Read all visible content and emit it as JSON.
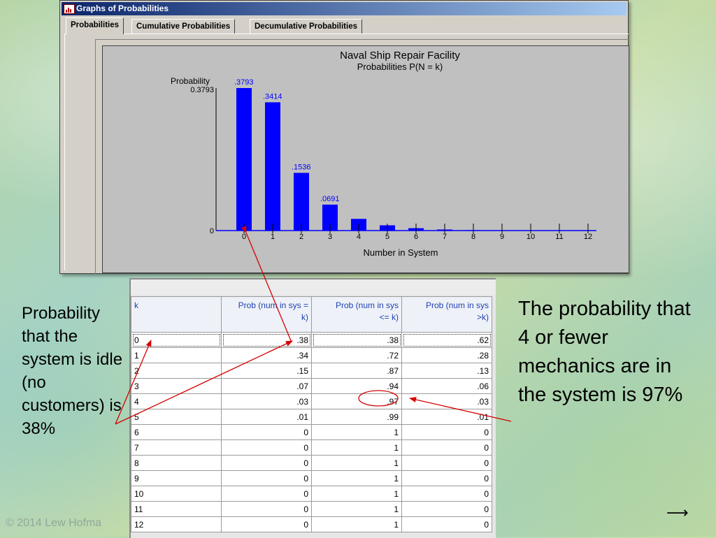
{
  "window": {
    "title": "Graphs of Probabilities",
    "tabs": [
      "Probabilities",
      "Cumulative Probabilities",
      "Decumulative Probabilities"
    ],
    "active_tab": "Probabilities"
  },
  "chart_data": {
    "type": "bar",
    "title": "Naval Ship Repair Facility",
    "subtitle": "Probabilities P(N = k)",
    "ylabel": "Probability",
    "xlabel": "Number in System",
    "ymax_label": "0.3793",
    "ymin_label": "0",
    "ylim": [
      0,
      0.3793
    ],
    "categories": [
      "0",
      "1",
      "2",
      "3",
      "4",
      "5",
      "6",
      "7",
      "8",
      "9",
      "10",
      "11",
      "12"
    ],
    "values": [
      0.3793,
      0.3414,
      0.1536,
      0.0691,
      0.0311,
      0.014,
      0.0063,
      0.0028,
      0.0013,
      0.0006,
      0.0003,
      0.0001,
      0.0001
    ],
    "data_labels": [
      ".3793",
      ".3414",
      ".1536",
      ".0691",
      "",
      "",
      "",
      "",
      "",
      "",
      "",
      "",
      ""
    ],
    "bar_color": "#0000ff"
  },
  "table": {
    "headers": [
      "k",
      "Prob (num in sys = k)",
      "Prob (num in sys <= k)",
      "Prob (num in sys >k)"
    ],
    "header_lines": [
      [
        "k"
      ],
      [
        "Prob (num in sys =",
        "k)"
      ],
      [
        "Prob (num in sys",
        "<= k)"
      ],
      [
        "Prob (num in sys",
        ">k)"
      ]
    ],
    "rows": [
      [
        "0",
        ".38",
        ".38",
        ".62"
      ],
      [
        "1",
        ".34",
        ".72",
        ".28"
      ],
      [
        "2",
        ".15",
        ".87",
        ".13"
      ],
      [
        "3",
        ".07",
        ".94",
        ".06"
      ],
      [
        "4",
        ".03",
        ".97",
        ".03"
      ],
      [
        "5",
        ".01",
        ".99",
        ".01"
      ],
      [
        "6",
        "0",
        "1",
        "0"
      ],
      [
        "7",
        "0",
        "1",
        "0"
      ],
      [
        "8",
        "0",
        "1",
        "0"
      ],
      [
        "9",
        "0",
        "1",
        "0"
      ],
      [
        "10",
        "0",
        "1",
        "0"
      ],
      [
        "11",
        "0",
        "1",
        "0"
      ],
      [
        "12",
        "0",
        "1",
        "0"
      ]
    ],
    "selected_row": 0,
    "highlighted_cell": ".97"
  },
  "annotations": {
    "left": "Probability that the system is idle (no customers) is 38%",
    "right": "The probability that 4 or fewer mechanics are in the system is 97%"
  },
  "footer": {
    "copyright": "© 2014 Lew Hofma",
    "next_arrow": "⟶"
  },
  "colors": {
    "annotation_arrow": "#d40000",
    "header_text": "#1f3fb0",
    "titlebar_start": "#0a246a",
    "titlebar_end": "#a6caf0"
  }
}
